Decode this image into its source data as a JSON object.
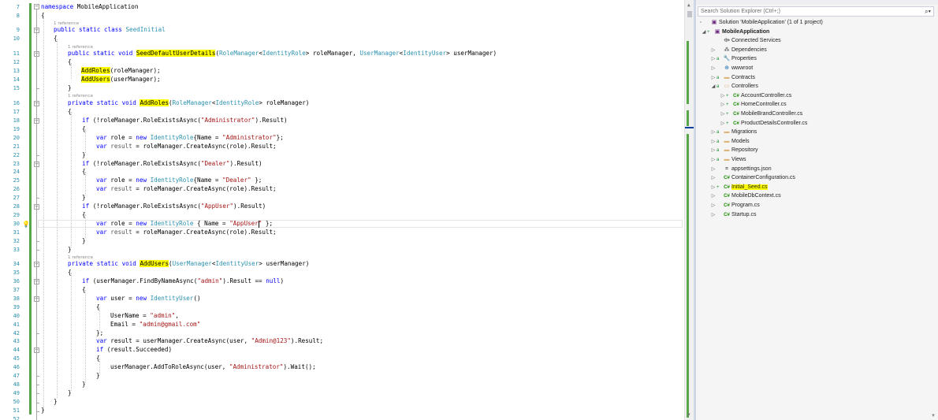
{
  "editor": {
    "line_numbers": [
      "7",
      "8",
      "9",
      "10",
      "11",
      "12",
      "13",
      "14",
      "15",
      "16",
      "17",
      "18",
      "19",
      "20",
      "21",
      "22",
      "23",
      "24",
      "25",
      "26",
      "27",
      "28",
      "29",
      "30",
      "31",
      "32",
      "33",
      "34",
      "35",
      "36",
      "37",
      "38",
      "39",
      "40",
      "41",
      "42",
      "43",
      "44",
      "45",
      "46",
      "47",
      "48",
      "49",
      "50",
      "51",
      "52"
    ],
    "reference_label": "1 reference",
    "lines": {
      "l7_kw": "namespace",
      "l7_name": " MobileApplication",
      "l8": "{",
      "l9_kw": "public static class ",
      "l9_type": "SeedInitial",
      "l10": "{",
      "l11_kw": "public static void ",
      "l11_method": "SeedDefaultUserDetails",
      "l11_p1": "(",
      "l11_t1": "RoleManager",
      "l11_p2": "<",
      "l11_t2": "IdentityRole",
      "l11_p3": "> roleManager, ",
      "l11_t3": "UserManager",
      "l11_p4": "<",
      "l11_t4": "IdentityUser",
      "l11_p5": "> userManager)",
      "l12": "{",
      "l13_method": "AddRoles",
      "l13_rest": "(roleManager);",
      "l14_method": "AddUsers",
      "l14_rest": "(userManager);",
      "l15": "}",
      "l16_kw": "private static void ",
      "l16_method": "AddRoles",
      "l16_p1": "(",
      "l16_t1": "RoleManager",
      "l16_p2": "<",
      "l16_t2": "IdentityRole",
      "l16_p3": "> roleManager)",
      "l17": "{",
      "l18_kw": "if",
      "l18_a": " (!roleManager.",
      "l18_b": "RoleExistsAsync",
      "l18_c": "(",
      "l18_s": "\"Administrator\"",
      "l18_d": ").Result)",
      "l19": "{",
      "l20_kw1": "var",
      "l20_a": " role = ",
      "l20_kw2": "new ",
      "l20_t": "IdentityRole",
      "l20_b": "{Name = ",
      "l20_s": "\"Administrator\"",
      "l20_c": "};",
      "l21_kw": "var",
      "l21_a": " ",
      "l21_f": "result",
      "l21_b": " = roleManager.",
      "l21_m": "CreateAsync",
      "l21_c": "(role).Result;",
      "l22": "}",
      "l23_kw": "if",
      "l23_a": " (!roleManager.",
      "l23_b": "RoleExistsAsync",
      "l23_c": "(",
      "l23_s": "\"Dealer\"",
      "l23_d": ").Result)",
      "l24": "{",
      "l25_kw1": "var",
      "l25_a": " role = ",
      "l25_kw2": "new ",
      "l25_t": "IdentityRole",
      "l25_b": "{Name = ",
      "l25_s": "\"Dealer\"",
      "l25_c": " };",
      "l26_kw": "var",
      "l26_a": " ",
      "l26_f": "result",
      "l26_b": " = roleManager.",
      "l26_m": "CreateAsync",
      "l26_c": "(role).Result;",
      "l27": "}",
      "l28_kw": "if",
      "l28_a": " (!roleManager.",
      "l28_b": "RoleExistsAsync",
      "l28_c": "(",
      "l28_s": "\"AppUser\"",
      "l28_d": ").Result)",
      "l29": "{",
      "l30_kw1": "var",
      "l30_a": " role = ",
      "l30_kw2": "new ",
      "l30_t": "IdentityRole",
      "l30_b": " { Name = ",
      "l30_s": "\"AppUser\"",
      "l30_c": " };",
      "l31_kw": "var",
      "l31_a": " ",
      "l31_f": "result",
      "l31_b": " = roleManager.",
      "l31_m": "CreateAsync",
      "l31_c": "(role).Result;",
      "l32": "}",
      "l33": "}",
      "l34_kw": "private static void ",
      "l34_method": "AddUsers",
      "l34_p1": "(",
      "l34_t1": "UserManager",
      "l34_p2": "<",
      "l34_t2": "IdentityUser",
      "l34_p3": "> userManager)",
      "l35": "{",
      "l36_kw1": "if",
      "l36_a": " (userManager.",
      "l36_b": "FindByNameAsync",
      "l36_c": "(",
      "l36_s": "\"admin\"",
      "l36_d": ").Result == ",
      "l36_kw2": "null",
      "l36_e": ")",
      "l37": "{",
      "l38_kw1": "var",
      "l38_a": " user = ",
      "l38_kw2": "new ",
      "l38_t": "IdentityUser",
      "l38_b": "()",
      "l39": "{",
      "l40_a": "UserName = ",
      "l40_s": "\"admin\"",
      "l40_b": ",",
      "l41_a": "Email = ",
      "l41_s": "\"admin@gmail.com\"",
      "l42": "};",
      "l43_kw": "var",
      "l43_a": " result = userManager.",
      "l43_m": "CreateAsync",
      "l43_b": "(user, ",
      "l43_s": "\"Admin@123\"",
      "l43_c": ").Result;",
      "l44_kw": "if",
      "l44_a": " (result.Succeeded)",
      "l45": "{",
      "l46_a": "userManager.",
      "l46_m": "AddToRoleAsync",
      "l46_b": "(user, ",
      "l46_s": "\"Administrator\"",
      "l46_c": ").",
      "l46_m2": "Wait",
      "l46_d": "();",
      "l47": "}",
      "l48": "}",
      "l49": "}",
      "l50": "}",
      "l51": "}"
    }
  },
  "solution_explorer": {
    "search_placeholder": "Search Solution Explorer (Ctrl+;)",
    "tree": [
      {
        "label": "Solution 'MobileApplication' (1 of 1 project)",
        "icon": "solution-icon"
      },
      {
        "label": "MobileApplication",
        "icon": "csharp-project-icon"
      },
      {
        "label": "Connected Services",
        "icon": "connected-services-icon"
      },
      {
        "label": "Dependencies",
        "icon": "dependencies-icon"
      },
      {
        "label": "Properties",
        "icon": "properties-folder-icon"
      },
      {
        "label": "wwwroot",
        "icon": "globe-icon"
      },
      {
        "label": "Contracts",
        "icon": "folder-icon"
      },
      {
        "label": "Controllers",
        "icon": "folder-open-icon"
      },
      {
        "label": "AccountController.cs",
        "icon": "csharp-file-icon"
      },
      {
        "label": "HomeController.cs",
        "icon": "csharp-file-icon"
      },
      {
        "label": "MobileBrandController.cs",
        "icon": "csharp-file-icon"
      },
      {
        "label": "ProductDetailsController.cs",
        "icon": "csharp-file-icon"
      },
      {
        "label": "Migrations",
        "icon": "folder-icon"
      },
      {
        "label": "Models",
        "icon": "folder-icon"
      },
      {
        "label": "Repository",
        "icon": "folder-icon"
      },
      {
        "label": "Views",
        "icon": "folder-icon"
      },
      {
        "label": "appsettings.json",
        "icon": "json-file-icon"
      },
      {
        "label": "ContainerConfiguration.cs",
        "icon": "csharp-file-icon"
      },
      {
        "label": "Initial_Seed.cs",
        "icon": "csharp-file-icon"
      },
      {
        "label": "MobileDbContext.cs",
        "icon": "csharp-file-icon"
      },
      {
        "label": "Program.cs",
        "icon": "csharp-file-icon"
      },
      {
        "label": "Startup.cs",
        "icon": "csharp-file-icon"
      }
    ],
    "csharp_badge": "C#",
    "status_added": "+",
    "status_lock": "a"
  },
  "colors": {
    "keyword": "#0000ff",
    "type": "#2b91af",
    "string": "#a31515",
    "highlight": "#ffff00",
    "line_number": "#2b91af",
    "changes_bar": "#57a64a"
  }
}
